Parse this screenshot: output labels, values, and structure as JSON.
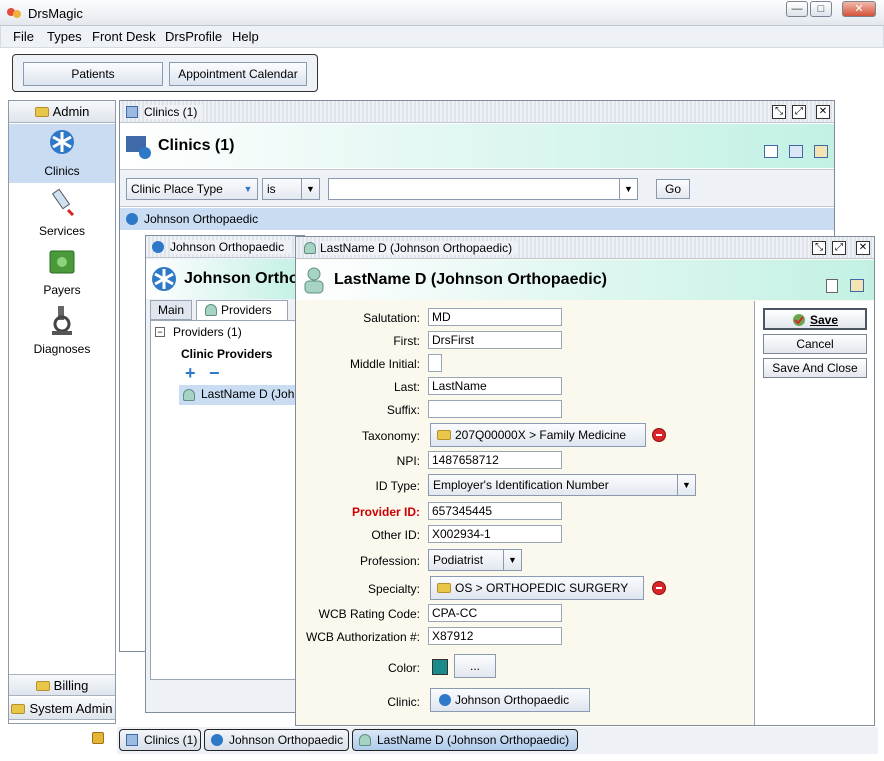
{
  "app": {
    "title": "DrsMagic"
  },
  "window_controls": {
    "minimize": "—",
    "maximize": "□",
    "close": "✕"
  },
  "menu": [
    "File",
    "Types",
    "Front Desk",
    "DrsProfile",
    "Help"
  ],
  "nav": {
    "patients": "Patients",
    "calendar": "Appointment Calendar"
  },
  "sidebar": {
    "admin": "Admin",
    "items": [
      {
        "label": "Clinics",
        "icon": "clinic-icon"
      },
      {
        "label": "Services",
        "icon": "syringe-icon"
      },
      {
        "label": "Payers",
        "icon": "money-icon"
      },
      {
        "label": "Diagnoses",
        "icon": "microscope-icon"
      }
    ],
    "billing": "Billing",
    "system_admin": "System Admin"
  },
  "clinics_frame": {
    "title": "Clinics (1)",
    "heading": "Clinics (1)",
    "filter": {
      "field": "Clinic Place Type",
      "operator": "is",
      "value": "",
      "go": "Go"
    },
    "rows": [
      "Johnson Orthopaedic"
    ]
  },
  "clinic_frame": {
    "title": "Johnson Orthopaedic",
    "heading": "Johnson Ortho",
    "tabs": [
      "Main",
      "Providers"
    ],
    "tree_root": "Providers (1)",
    "section": "Clinic Providers",
    "add": "+",
    "remove": "−",
    "providers": [
      "LastName D (Joh"
    ]
  },
  "provider_frame": {
    "title": "LastName D (Johnson Orthopaedic)",
    "heading": "LastName D (Johnson Orthopaedic)",
    "fields": {
      "salutation": {
        "label": "Salutation:",
        "value": "MD"
      },
      "first": {
        "label": "First:",
        "value": "DrsFirst"
      },
      "middle": {
        "label": "Middle Initial:",
        "value": ""
      },
      "last": {
        "label": "Last:",
        "value": "LastName"
      },
      "suffix": {
        "label": "Suffix:",
        "value": ""
      },
      "taxonomy": {
        "label": "Taxonomy:",
        "value": "207Q00000X > Family Medicine"
      },
      "npi": {
        "label": "NPI:",
        "value": "1487658712"
      },
      "id_type": {
        "label": "ID Type:",
        "value": "Employer's Identification Number"
      },
      "provider_id": {
        "label": "Provider ID:",
        "value": "657345445"
      },
      "other_id": {
        "label": "Other ID:",
        "value": "X002934-1"
      },
      "profession": {
        "label": "Profession:",
        "value": "Podiatrist"
      },
      "specialty": {
        "label": "Specialty:",
        "value": "OS > ORTHOPEDIC SURGERY"
      },
      "wcb_rating": {
        "label": "WCB Rating Code:",
        "value": "CPA-CC"
      },
      "wcb_auth": {
        "label": "WCB Authorization #:",
        "value": "X87912"
      },
      "color": {
        "label": "Color:",
        "value": "#1a8a8a",
        "button": "..."
      },
      "clinic": {
        "label": "Clinic:",
        "value": "Johnson Orthopaedic"
      }
    },
    "buttons": {
      "save": "Save",
      "cancel": "Cancel",
      "save_close": "Save And Close"
    }
  },
  "taskbar": [
    "Clinics (1)",
    "Johnson Orthopaedic",
    "LastName D (Johnson Orthopaedic)"
  ],
  "colors": {
    "required_label": "#cc0000",
    "teal_swatch": "#1a8a8a",
    "header_gradient_end": "#c2f1e3"
  }
}
